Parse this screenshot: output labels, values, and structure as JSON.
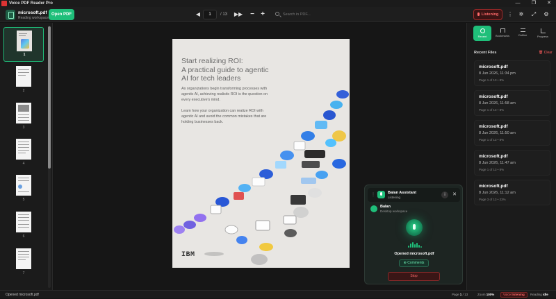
{
  "window": {
    "title": "Voice PDF Reader Pro",
    "controls": [
      "—",
      "❐",
      "✕"
    ]
  },
  "toolbar": {
    "file_name": "microsoft.pdf",
    "file_subtitle": "Reading workspace",
    "open_label": "Open PDF",
    "current_page": "1",
    "page_total": "/ 13",
    "search_placeholder": "Search in PDF...",
    "listening_label": "Listening",
    "icons": [
      "kebab-menu-icon",
      "settings-gear-icon",
      "fullscreen-icon",
      "gear-icon"
    ]
  },
  "thumbnails": [
    {
      "num": "1"
    },
    {
      "num": "2"
    },
    {
      "num": "3"
    },
    {
      "num": "4"
    },
    {
      "num": "5"
    },
    {
      "num": "6"
    },
    {
      "num": "7"
    }
  ],
  "document": {
    "title": "Start realizing ROI:\nA practical guide to agentic\nAI for tech leaders",
    "para1": "As organizations begin transforming processes with agentic AI, achieving realistic ROI is the question on every executive's mind.",
    "para2": "Learn how your organization can realize ROI with agentic AI and avoid the common mistakes that are holding businesses back.",
    "logo": "IBM"
  },
  "right_panel": {
    "tabs": [
      {
        "label": "Recent",
        "icon": "clock-icon"
      },
      {
        "label": "Bookmarks",
        "icon": "bookmark-icon"
      },
      {
        "label": "Outline",
        "icon": "outline-icon"
      },
      {
        "label": "Progress",
        "icon": "progress-icon"
      }
    ],
    "recent_heading": "Recent Files",
    "clear_label": "Clear",
    "files": [
      {
        "name": "microsoft.pdf",
        "date": "8 Jun 2026, 11:34 pm",
        "progress": "Page 1 of 13 • 8%"
      },
      {
        "name": "microsoft.pdf",
        "date": "8 Jun 2026, 11:58 am",
        "progress": "Page 1 of 13 • 8%"
      },
      {
        "name": "microsoft.pdf",
        "date": "8 Jun 2026, 11:50 am",
        "progress": "Page 1 of 13 • 8%"
      },
      {
        "name": "microsoft.pdf",
        "date": "8 Jun 2026, 11:47 am",
        "progress": "Page 1 of 13 • 8%"
      },
      {
        "name": "microsoft.pdf",
        "date": "8 Jun 2026, 11:12 am",
        "progress": "Page 3 of 13 • 23%"
      }
    ]
  },
  "assistant": {
    "title": "Balan Assistant",
    "status": "Listening",
    "user_name": "Balan",
    "user_sub": "Desktop workspace",
    "message": "Opened microsoft.pdf",
    "comments_label": "Comments",
    "stop_label": "Stop",
    "info_glyph": "i",
    "close_glyph": "✕"
  },
  "status_bar": {
    "message": "Opened microsoft.pdf",
    "page_label": "Page",
    "page_value": "1",
    "page_total": "/ 13",
    "zoom_label": "Zoom",
    "zoom_value": "100%",
    "voice_label": "Voice",
    "voice_value": "listening",
    "reading_label": "Reading",
    "reading_value": "idle"
  },
  "colors": {
    "accent": "#1fbf7a",
    "danger": "#ff6b6b",
    "background": "#141414"
  }
}
